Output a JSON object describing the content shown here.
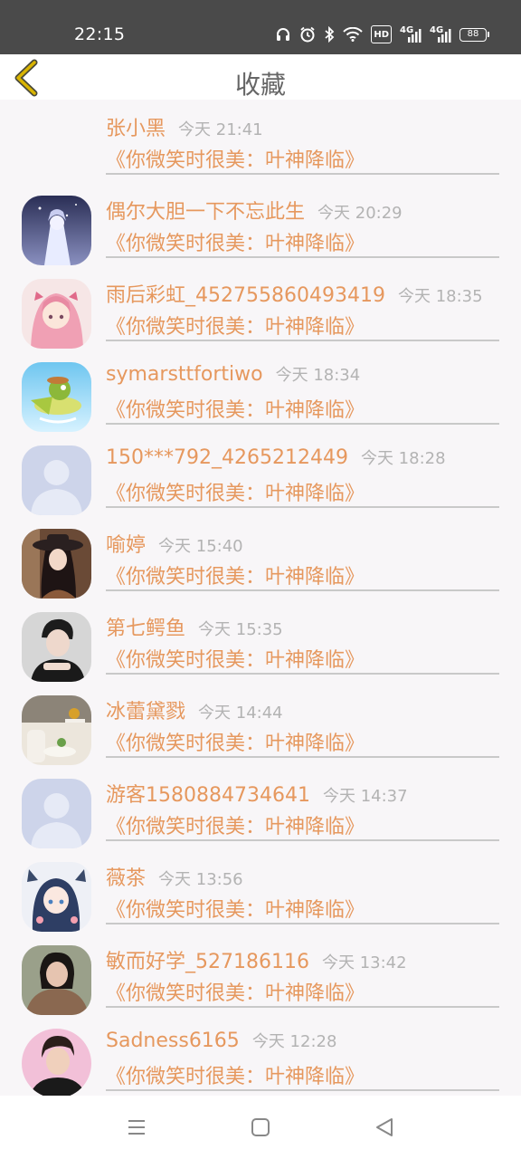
{
  "status_bar": {
    "time": "22:15",
    "icons": [
      "headphones-icon",
      "alarm-icon",
      "bluetooth-icon",
      "wifi-icon",
      "hd-icon",
      "signal-4g-icon",
      "signal-4g-icon",
      "battery-icon"
    ],
    "hd_label": "HD",
    "net1_label": "4G",
    "net2_label": "4G",
    "battery_level": "88"
  },
  "header": {
    "title": "收藏",
    "back_icon": "chevron-left-icon"
  },
  "items": [
    {
      "name": "张小黑",
      "time": "今天 21:41",
      "book": "《你微笑时很美：叶神降临》",
      "avatar": "none"
    },
    {
      "name": "偶尔大胆一下不忘此生",
      "time": "今天 20:29",
      "book": "《你微笑时很美：叶神降临》",
      "avatar": "anime-night"
    },
    {
      "name": "雨后彩虹_452755860493419",
      "time": "今天 18:35",
      "book": "《你微笑时很美：叶神降临》",
      "avatar": "anime-pink"
    },
    {
      "name": "symarsttfortiwo",
      "time": "今天 18:34",
      "book": "《你微笑时很美：叶神降临》",
      "avatar": "cartoon-plane"
    },
    {
      "name": "150***792_4265212449",
      "time": "今天 18:28",
      "book": "《你微笑时很美：叶神降临》",
      "avatar": "default"
    },
    {
      "name": "喻婷",
      "time": "今天 15:40",
      "book": "《你微笑时很美：叶神降临》",
      "avatar": "photo-woman-hat"
    },
    {
      "name": "第七鳄鱼",
      "time": "今天 15:35",
      "book": "《你微笑时很美：叶神降临》",
      "avatar": "photo-man"
    },
    {
      "name": "冰蕾黛戮",
      "time": "今天 14:44",
      "book": "《你微笑时很美：叶神降临》",
      "avatar": "photo-room"
    },
    {
      "name": "游客1580884734641",
      "time": "今天 14:37",
      "book": "《你微笑时很美：叶神降临》",
      "avatar": "default"
    },
    {
      "name": "薇茶",
      "time": "今天 13:56",
      "book": "《你微笑时很美：叶神降临》",
      "avatar": "anime-girl"
    },
    {
      "name": "敏而好学_527186116",
      "time": "今天 13:42",
      "book": "《你微笑时很美：叶神降临》",
      "avatar": "photo-woman"
    },
    {
      "name": "Sadness6165",
      "time": "今天 12:28",
      "book": "《你微笑时很美：叶神降临》",
      "avatar": "photo-young-man"
    }
  ],
  "nav_bar": {
    "buttons": [
      "menu-icon",
      "home-square-icon",
      "back-triangle-icon"
    ]
  },
  "colors": {
    "accent": "#e6985e",
    "time_text": "#b3b3b3",
    "status_bar_bg": "#4a4a4a",
    "back_chevron": "#c9a200"
  }
}
